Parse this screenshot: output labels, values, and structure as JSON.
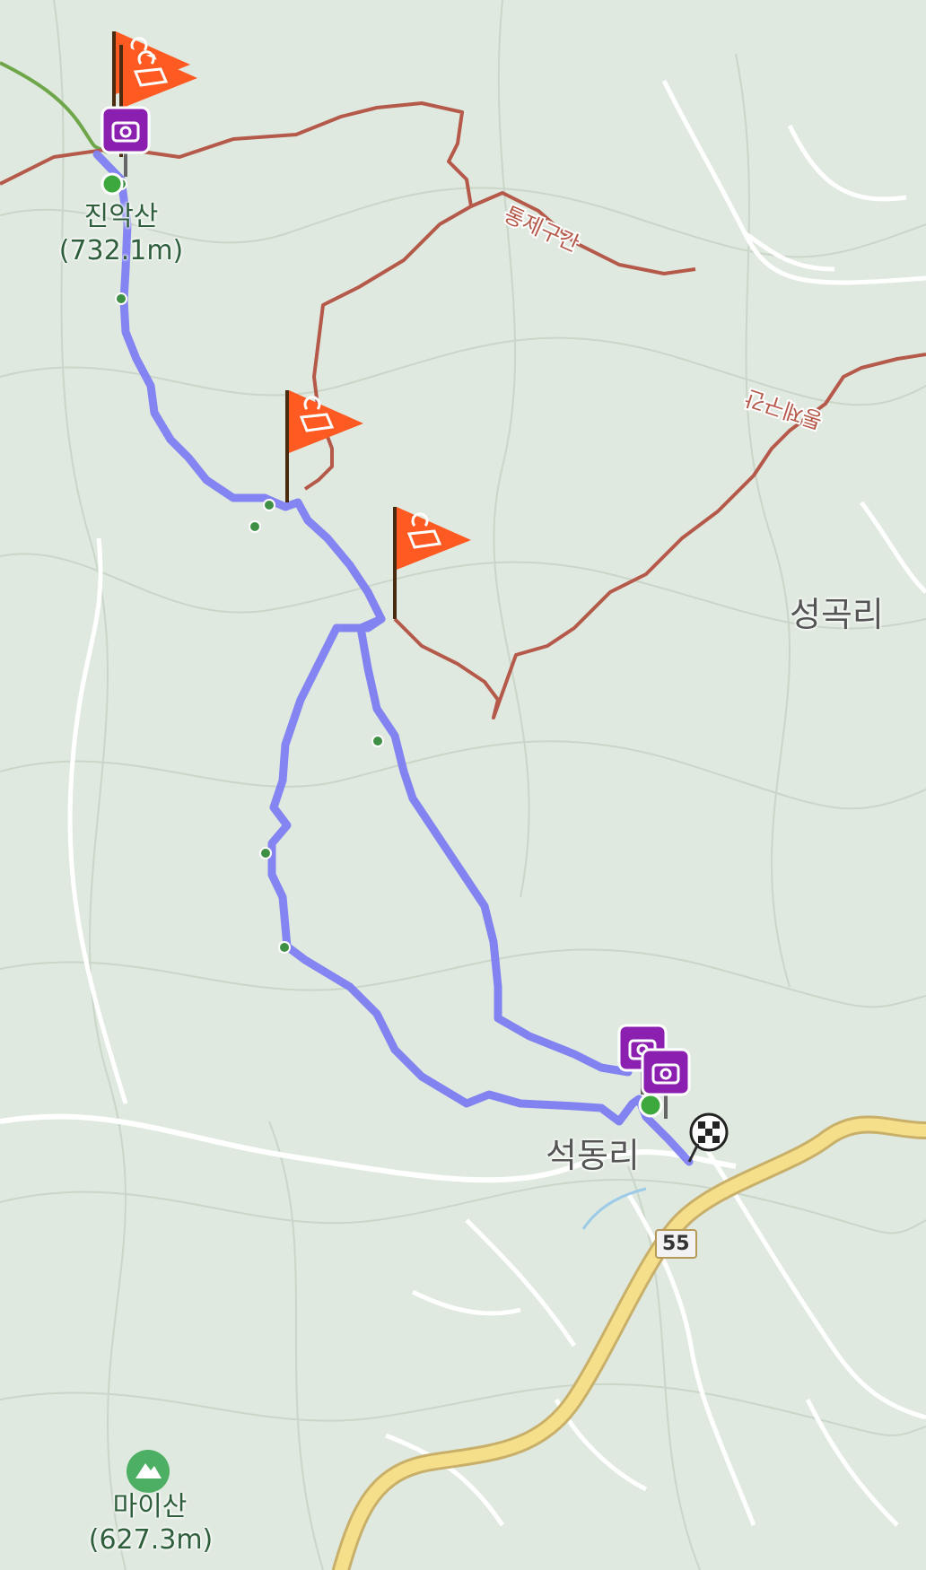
{
  "map": {
    "colors": {
      "background": "#dfe9df",
      "contour": "#c9d6c8",
      "route": "#7e7ef2",
      "boundary": "#b5594a",
      "road_main": "#f5df8a",
      "road_minor": "#ffffff",
      "flag": "#ff5a22",
      "camera": "#8a1fb0",
      "peak_icon": "#4caf64",
      "waypoint": "#3f8f45"
    },
    "peaks": [
      {
        "name": "진악산",
        "elevation": "(732.1m)",
        "icon": "mountain-icon"
      },
      {
        "name": "마이산",
        "elevation": "(627.3m)",
        "icon": "mountain-icon"
      }
    ],
    "places": [
      {
        "name": "성곡리"
      },
      {
        "name": "석동리"
      }
    ],
    "boundary_labels": [
      {
        "text": "통제구간"
      },
      {
        "text": "통제구간"
      }
    ],
    "road_badge": "55",
    "icons": {
      "flag": "hazard-flag-icon",
      "camera": "camera-marker-icon",
      "finish": "checkered-finish-icon",
      "start": "start-marker-icon"
    }
  }
}
